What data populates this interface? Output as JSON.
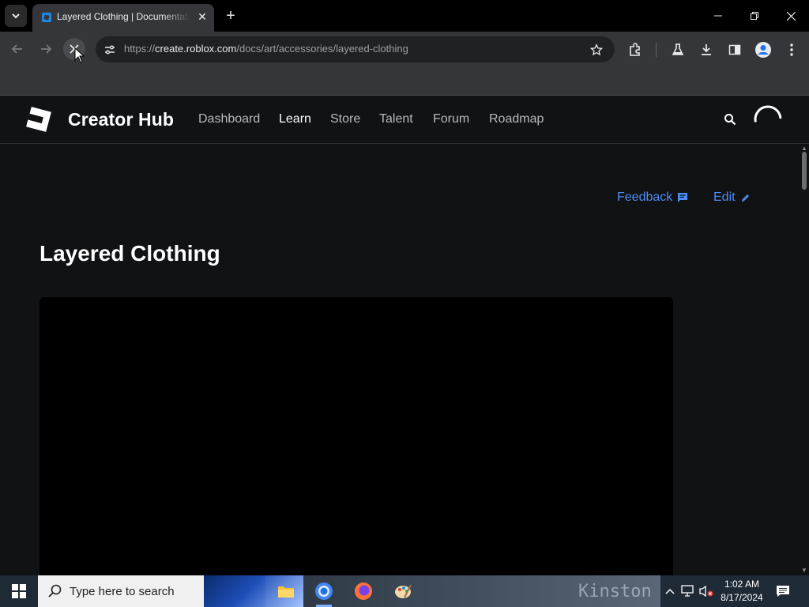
{
  "browser": {
    "tab": {
      "title": "Layered Clothing | Documentation - Roblox Creator Hub"
    },
    "address": {
      "scheme": "https://",
      "host": "create.roblox.com",
      "path": "/docs/art/accessories/layered-clothing"
    }
  },
  "header": {
    "brand": "Creator Hub",
    "nav": [
      "Dashboard",
      "Learn",
      "Store",
      "Talent",
      "Forum",
      "Roadmap"
    ],
    "active_nav": "Learn"
  },
  "page": {
    "feedback_label": "Feedback",
    "edit_label": "Edit",
    "title": "Layered Clothing"
  },
  "taskbar": {
    "search_placeholder": "Type here to search",
    "time": "1:02 AM",
    "date": "8/17/2024",
    "wallpaper_text": "Kinston"
  },
  "colors": {
    "accent_link": "#4c8df6",
    "page_bg": "#111214",
    "chrome_bg": "#35363a"
  }
}
